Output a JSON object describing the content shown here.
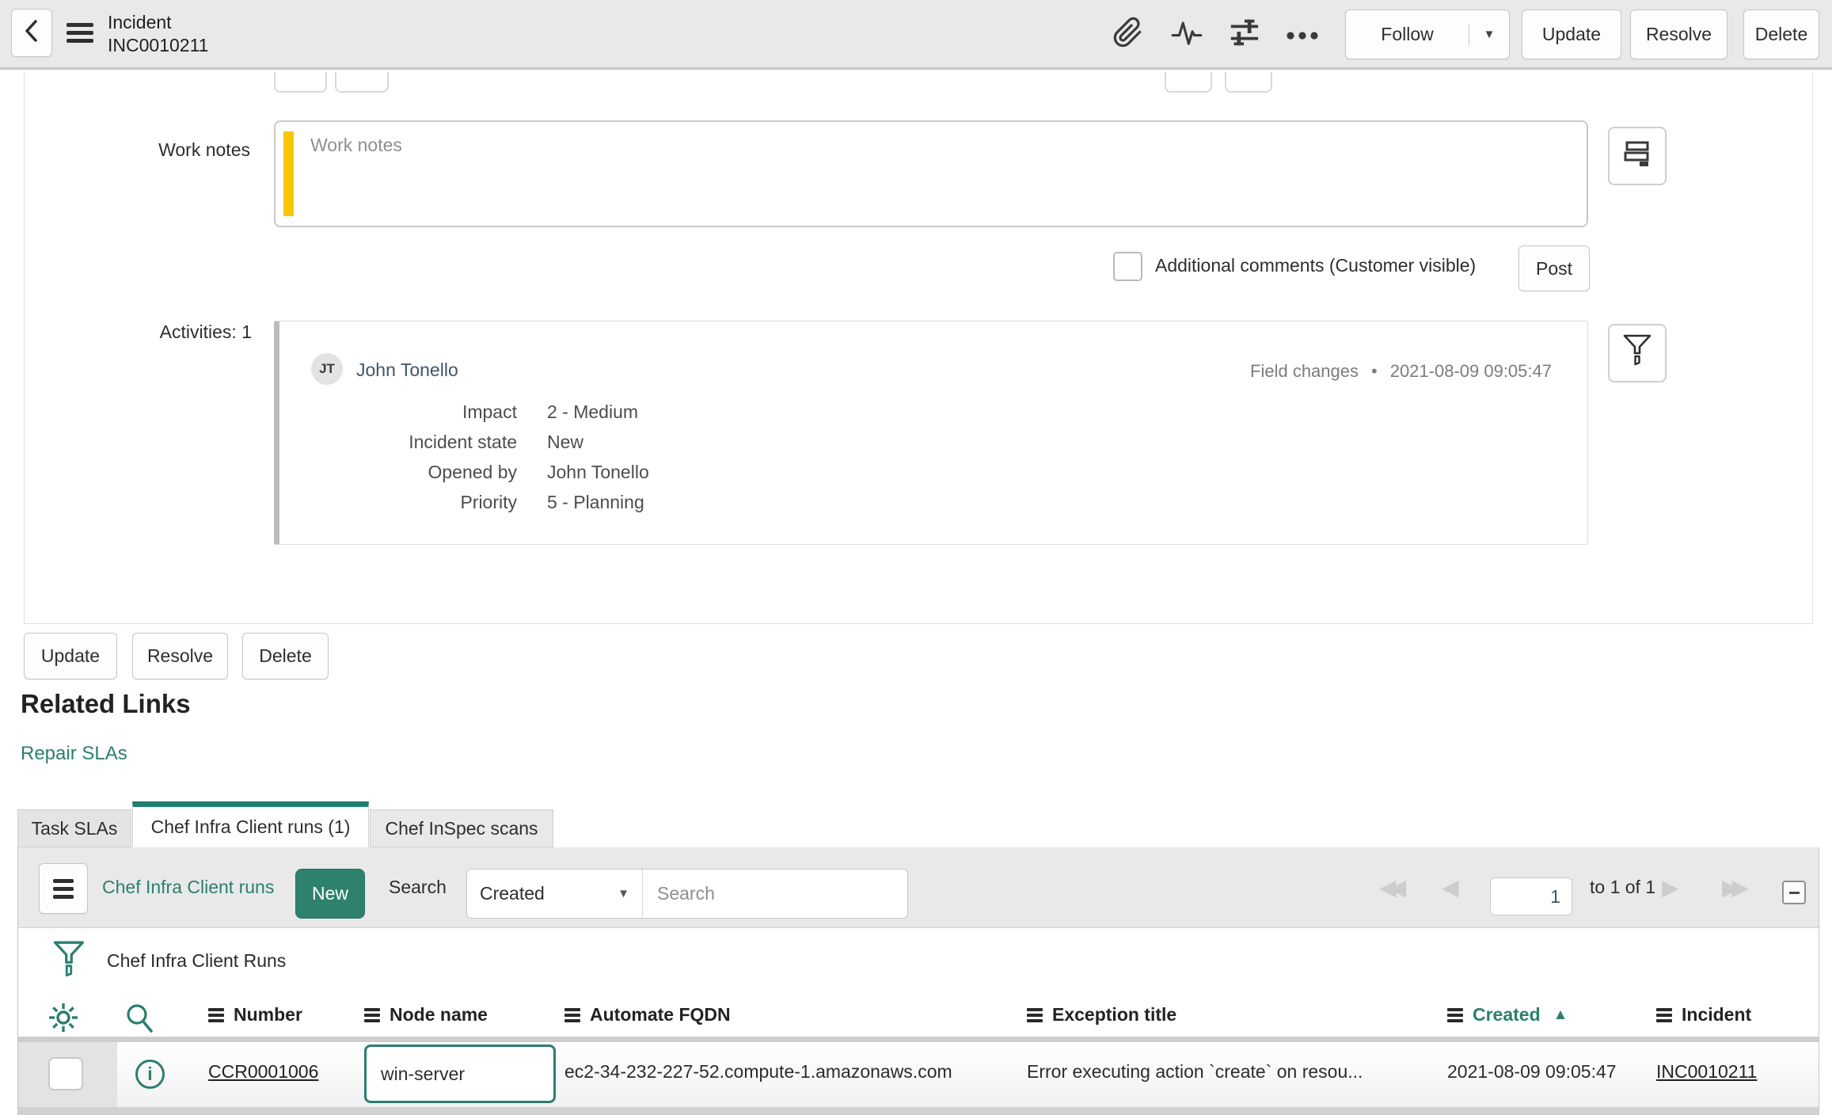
{
  "colors": {
    "teal": "#2B7F6F",
    "teal_button": "#2E826D",
    "yellow": "#F6C700"
  },
  "icons": {
    "caret_down": "▼",
    "sort_ascending": "▲",
    "bullet": "•",
    "first_page": "◀◀",
    "prev_page": "◀",
    "next_page": "▶",
    "last_page": "▶▶"
  },
  "header": {
    "title": "Incident",
    "number": "INC0010211",
    "follow_label": "Follow",
    "update_label": "Update",
    "resolve_label": "Resolve",
    "delete_label": "Delete"
  },
  "work_notes": {
    "label": "Work notes",
    "placeholder": "Work notes"
  },
  "comments": {
    "checkbox_label": "Additional comments (Customer visible)",
    "post_label": "Post"
  },
  "activities": {
    "label": "Activities: 1",
    "entry": {
      "initials": "JT",
      "user": "John Tonello",
      "event_type": "Field changes",
      "timestamp": "2021-08-09 09:05:47",
      "changes": [
        {
          "field": "Impact",
          "value": "2 - Medium"
        },
        {
          "field": "Incident state",
          "value": "New"
        },
        {
          "field": "Opened by",
          "value": "John Tonello"
        },
        {
          "field": "Priority",
          "value": "5 - Planning"
        }
      ]
    }
  },
  "form_footer": {
    "update_label": "Update",
    "resolve_label": "Resolve",
    "delete_label": "Delete"
  },
  "related_links": {
    "heading": "Related Links",
    "repair_slas": "Repair SLAs"
  },
  "tabs": [
    {
      "label": "Task SLAs"
    },
    {
      "label": "Chef Infra Client runs (1)"
    },
    {
      "label": "Chef InSpec scans"
    }
  ],
  "related_list": {
    "title": "Chef Infra Client runs",
    "new_label": "New",
    "search_label": "Search",
    "search_column": "Created",
    "search_placeholder": "Search",
    "page_value": "1",
    "page_range": "to 1 of 1",
    "breadcrumb": "Chef Infra Client Runs",
    "columns": [
      {
        "label": "Number"
      },
      {
        "label": "Node name"
      },
      {
        "label": "Automate FQDN"
      },
      {
        "label": "Exception title"
      },
      {
        "label": "Created"
      },
      {
        "label": "Incident"
      }
    ],
    "sort": {
      "column": "Created",
      "direction": "ascending"
    },
    "rows": [
      {
        "number": "CCR0001006",
        "node_name": "win-server",
        "automate_fqdn": "ec2-34-232-227-52.compute-1.amazonaws.com",
        "exception_title": "Error executing action `create` on resou...",
        "created": "2021-08-09 09:05:47",
        "incident": "INC0010211"
      }
    ]
  }
}
